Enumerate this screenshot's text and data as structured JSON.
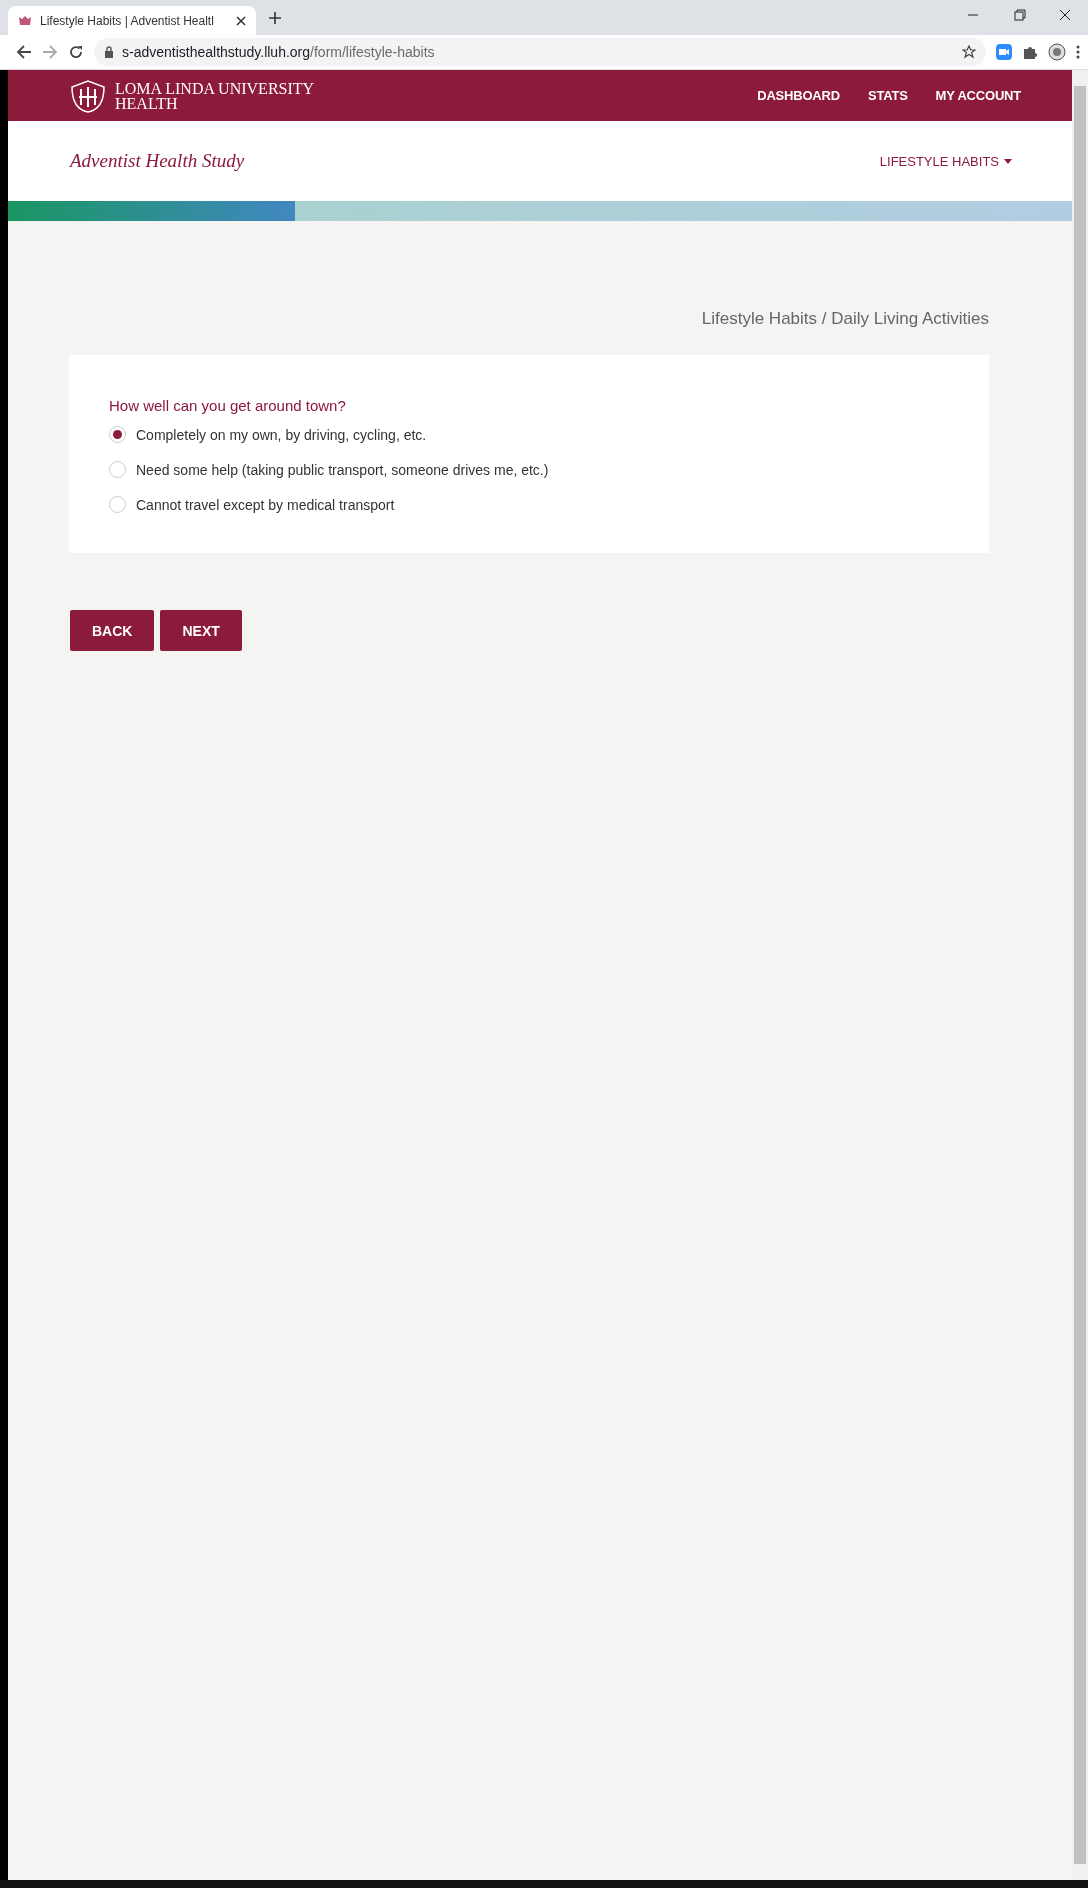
{
  "browser": {
    "tab_title": "Lifestyle Habits | Adventist Healtl",
    "url_host": "s-adventisthealthstudy.lluh.org",
    "url_path": "/form/lifestyle-habits"
  },
  "top_nav": {
    "brand_line_1": "LOMA LINDA UNIVERSITY",
    "brand_line_2": "HEALTH",
    "links": [
      "DASHBOARD",
      "STATS",
      "MY ACCOUNT"
    ]
  },
  "sub_header": {
    "title": "Adventist Health Study",
    "menu": "LIFESTYLE HABITS"
  },
  "progress": {
    "level": 0.27
  },
  "breadcrumb": "Lifestyle Habits / Daily Living Activities",
  "question": {
    "prompt": "How well can you get around town?",
    "options": [
      {
        "label": "Completely on my own, by driving, cycling, etc.",
        "selected": true
      },
      {
        "label": "Need some help (taking public transport, someone drives me, etc.)",
        "selected": false
      },
      {
        "label": "Cannot travel except by medical transport",
        "selected": false
      }
    ]
  },
  "buttons": [
    "BACK",
    "NEXT"
  ]
}
